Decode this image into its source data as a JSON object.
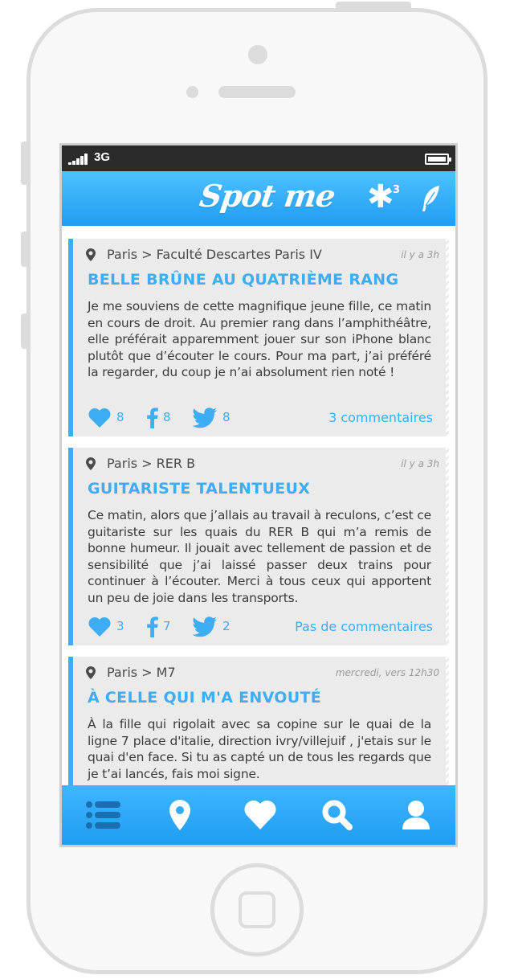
{
  "status_bar": {
    "network": "3G"
  },
  "app": {
    "title": "Spot me",
    "notification_count": "3"
  },
  "posts": [
    {
      "location": "Paris > Faculté Descartes Paris IV",
      "time": "il y a 3h",
      "title": "BELLE BRÛNE AU QUATRIÈME RANG",
      "body": "Je me souviens de cette magnifique jeune fille, ce matin en cours de droit. Au premier rang dans l’amphithéâtre, elle préférait apparemment jouer sur son iPhone blanc plutôt que d’écouter le cours. Pour ma part, j’ai préféré la regarder, du coup je n’ai absolument rien noté !",
      "likes": "8",
      "facebook": "8",
      "twitter": "8",
      "comments": "3 commentaires"
    },
    {
      "location": "Paris > RER B",
      "time": "il y a 3h",
      "title": "GUITARISTE TALENTUEUX",
      "body": "Ce matin, alors que j’allais au travail à reculons, c’est ce guitariste sur les quais du RER B qui m’a remis de bonne humeur. Il jouait avec tellement de passion et de sensibilité que j’ai laissé passer deux trains pour continuer à l’écouter. Merci à tous ceux qui apportent un peu de joie dans les transports.",
      "likes": "3",
      "facebook": "7",
      "twitter": "2",
      "comments": "Pas de commentaires"
    },
    {
      "location": "Paris > M7",
      "time": "mercredi, vers 12h30",
      "title": "À CELLE QUI M'A ENVOUTÉ",
      "body": "À la fille qui rigolait avec sa copine sur le quai de la ligne 7 place d'italie, direction ivry/villejuif , j'etais sur le quai d'en face. Si tu as capté un de tous les regards que je t’ai lancés, fais moi signe."
    }
  ],
  "tabs": [
    {
      "icon": "list-icon",
      "active": true
    },
    {
      "icon": "map-pin-icon",
      "active": false
    },
    {
      "icon": "heart-icon",
      "active": false
    },
    {
      "icon": "search-icon",
      "active": false
    },
    {
      "icon": "profile-icon",
      "active": false
    }
  ],
  "colors": {
    "accent": "#3daef5",
    "card_bg": "#ebebeb",
    "status_bar": "#2b2b2b"
  }
}
